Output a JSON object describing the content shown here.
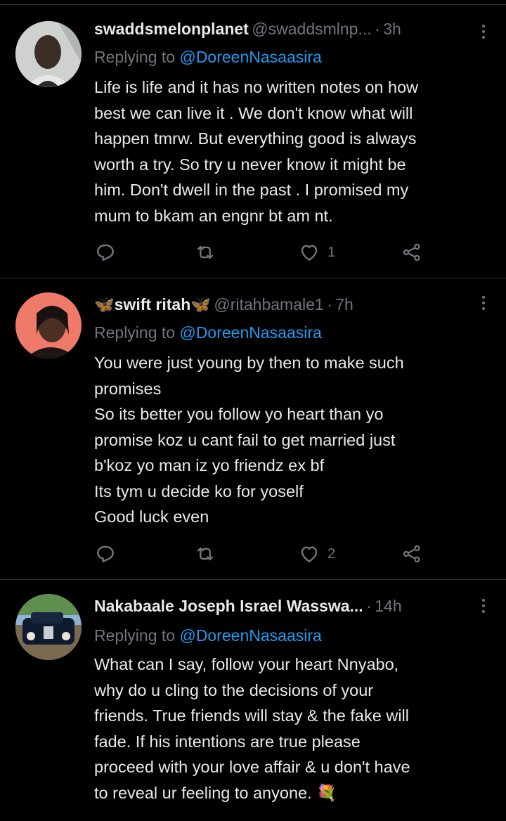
{
  "tweets": [
    {
      "name": "swaddsmelonplanet",
      "handle": "@swaddsmlnp...",
      "separator": "·",
      "time": "3h",
      "replying_prefix": "Replying to",
      "replying_to": "@DoreenNasaasira",
      "text": "Life is life and it has no written notes on how\nbest we can live it . We don't know what will\nhappen tmrw. But everything good is always\nworth a try. So try u never know it might be\nhim. Don't dwell in the past . I promised my\nmum to bkam an engnr bt am nt.",
      "replies": "",
      "retweets": "",
      "likes": "1"
    },
    {
      "name_prefix_emoji": "🦋",
      "name": "swift ritah",
      "name_suffix_emoji": "🦋",
      "handle": "@ritahbamale1",
      "separator": "·",
      "time": "7h",
      "replying_prefix": "Replying to",
      "replying_to": "@DoreenNasaasira",
      "text": "You were just young by then to make such\npromises\nSo its better you follow yo heart than yo\npromise koz u cant fail to get married just\nb'koz yo man iz yo friendz ex bf\nIts tym u decide ko for yoself\nGood luck even",
      "replies": "",
      "retweets": "",
      "likes": "2"
    },
    {
      "name": "Nakabaale Joseph Israel Wasswa...",
      "handle": "",
      "separator": "·",
      "time": "14h",
      "replying_prefix": "Replying to",
      "replying_to": "@DoreenNasaasira",
      "text": "What can I say, follow your heart Nnyabo,\nwhy do u cling to the decisions of your\nfriends. True friends will stay & the fake will\nfade. If his intentions are true please\nproceed with your love affair & u don't have\nto reveal ur feeling to anyone.",
      "text_trailing_emoji": "💐"
    }
  ],
  "icons": {
    "reply": "reply-icon",
    "retweet": "retweet-icon",
    "like": "heart-icon",
    "share": "share-icon",
    "more": "more-icon"
  },
  "colors": {
    "background": "#000000",
    "text": "#e7e9ea",
    "muted": "#71767b",
    "link": "#1d9bf0",
    "divider": "#2f3336"
  }
}
